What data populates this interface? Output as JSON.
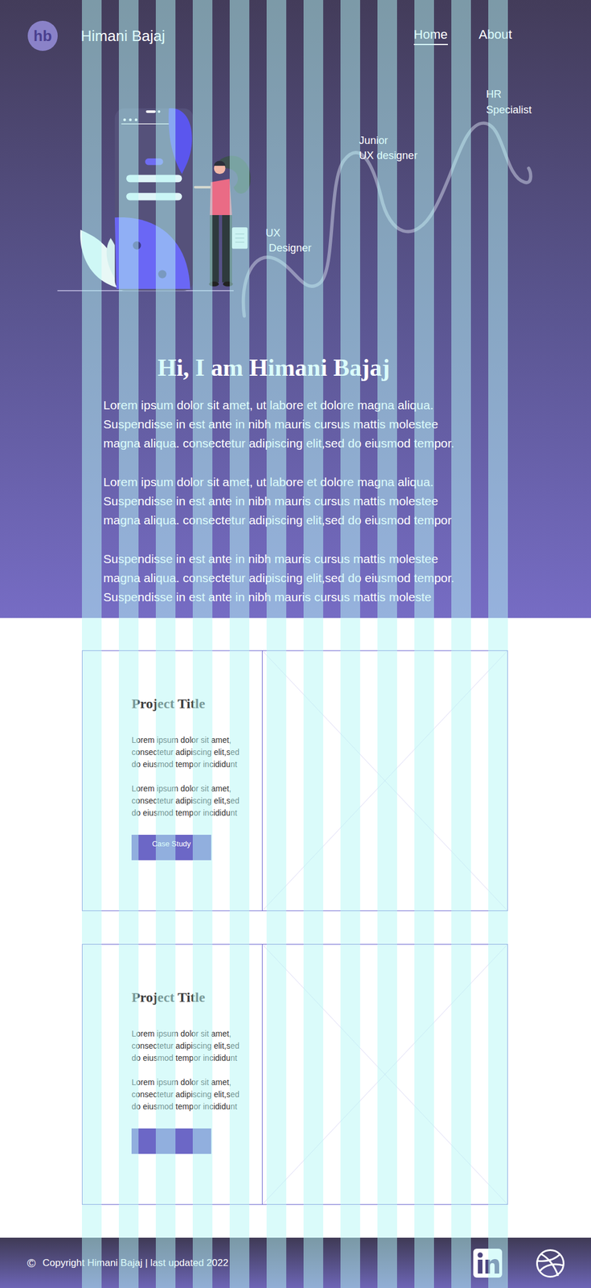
{
  "header": {
    "logo": "hb",
    "name": "Himani Bajaj",
    "nav": [
      {
        "label": "Home",
        "selected": true
      },
      {
        "label": "About",
        "selected": false
      }
    ]
  },
  "career_path": [
    {
      "lines": [
        "UX",
        "Designer"
      ]
    },
    {
      "lines": [
        "Junior",
        "UX designer"
      ]
    },
    {
      "lines": [
        "HR",
        "Specialist"
      ]
    }
  ],
  "hero": {
    "heading": "Hi, I am Himani Bajaj",
    "paragraphs": [
      [
        "Lorem ipsum dolor sit amet, ut labore  et dolore magna aliqua.",
        "Suspendisse in est ante in nibh mauris cursus mattis molestee",
        "magna aliqua. consectetur adipiscing elit,sed do eiusmod tempor."
      ],
      [
        "Lorem ipsum dolor sit amet, ut labore  et dolore magna aliqua.",
        "Suspendisse in est ante in nibh mauris cursus mattis molestee",
        "magna aliqua. consectetur adipiscing elit,sed do eiusmod tempor"
      ],
      [
        "Suspendisse in est ante in nibh mauris cursus mattis molestee",
        "magna aliqua. consectetur adipiscing elit,sed do eiusmod tempor.",
        "Suspendisse in est ante in nibh mauris cursus mattis moleste"
      ]
    ]
  },
  "projects": [
    {
      "title": "Project Title",
      "paragraphs": [
        [
          "Lorem ipsum dolor sit amet,",
          "consectetur adipiscing elit,sed",
          "do eiusmod tempor incididunt"
        ],
        [
          "Lorem ipsum dolor sit amet,",
          "consectetur adipiscing elit,sed",
          "do eiusmod tempor incididunt"
        ]
      ],
      "button": "Case Study"
    },
    {
      "title": "Project Title",
      "paragraphs": [
        [
          "Lorem ipsum dolor sit amet,",
          "consectetur adipiscing elit,sed",
          "do eiusmod tempor incididunt"
        ],
        [
          "Lorem ipsum dolor sit amet,",
          "consectetur adipiscing elit,sed",
          "do eiusmod tempor incididunt"
        ]
      ],
      "button": ""
    }
  ],
  "footer": {
    "symbol": "©",
    "text": "Copyright Himani Bajaj | last updated 2022"
  }
}
